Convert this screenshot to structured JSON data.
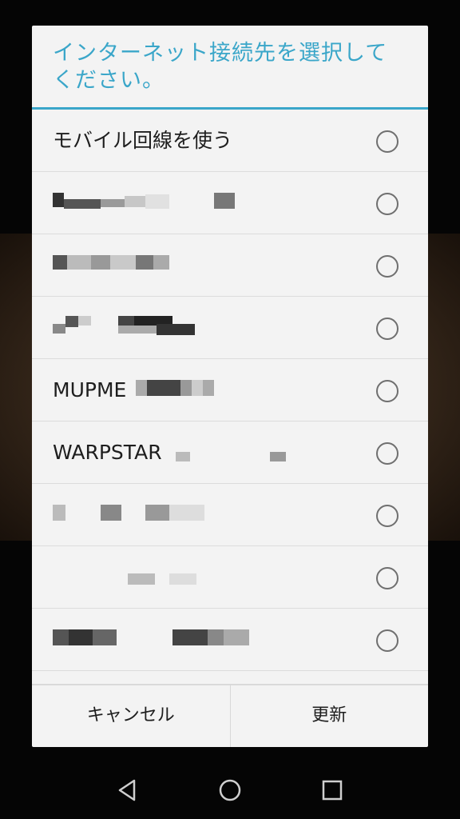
{
  "dialog": {
    "title": "インターネット接続先を選択して\nください。",
    "accent_color": "#3aa6c9",
    "items": [
      {
        "label": "モバイル回線を使う",
        "selected": false
      },
      {
        "label": "",
        "selected": false,
        "redacted": true
      },
      {
        "label": "",
        "selected": false,
        "redacted": true
      },
      {
        "label": "",
        "selected": false,
        "redacted": true
      },
      {
        "label": "MUPME",
        "selected": false,
        "redacted": true
      },
      {
        "label": "WARPSTAR",
        "selected": false,
        "redacted": true
      },
      {
        "label": "",
        "selected": false,
        "redacted": true
      },
      {
        "label": "",
        "selected": false,
        "redacted": true
      },
      {
        "label": "",
        "selected": false,
        "redacted": true
      }
    ],
    "buttons": {
      "cancel": "キャンセル",
      "refresh": "更新"
    }
  },
  "navbar": {
    "back": "back-icon",
    "home": "home-icon",
    "recents": "recents-icon"
  }
}
